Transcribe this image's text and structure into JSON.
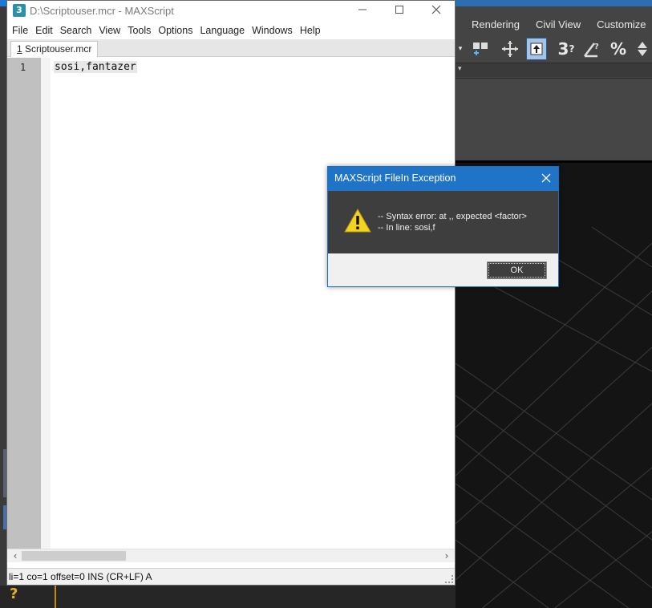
{
  "editor": {
    "title": "D:\\Scriptouser.mcr - MAXScript",
    "app_icon": "3",
    "menu": [
      "File",
      "Edit",
      "Search",
      "View",
      "Tools",
      "Options",
      "Language",
      "Windows",
      "Help"
    ],
    "tab": {
      "index": "1",
      "name": " Scriptouser.mcr"
    },
    "line_number": "1",
    "code": "sosi,fantazer",
    "status": "li=1 co=1 offset=0 INS (CR+LF) A"
  },
  "dialog": {
    "title": "MAXScript FileIn Exception",
    "line1": "-- Syntax error: at ,, expected <factor>",
    "line2": "--  In line: sosi,f",
    "ok_label": "OK"
  },
  "background": {
    "menu": [
      "Rendering",
      "Civil View",
      "Customize"
    ]
  },
  "colors": {
    "dialog_title": "#1f74c8",
    "dialog_body": "#3e3e3e",
    "gutter": "#c0c0c0",
    "max_panel": "#444444",
    "viewport": "#141414"
  },
  "icons": {
    "dialog": "warning-icon",
    "window_controls": [
      "minimize-icon",
      "maximize-icon",
      "close-icon"
    ]
  }
}
